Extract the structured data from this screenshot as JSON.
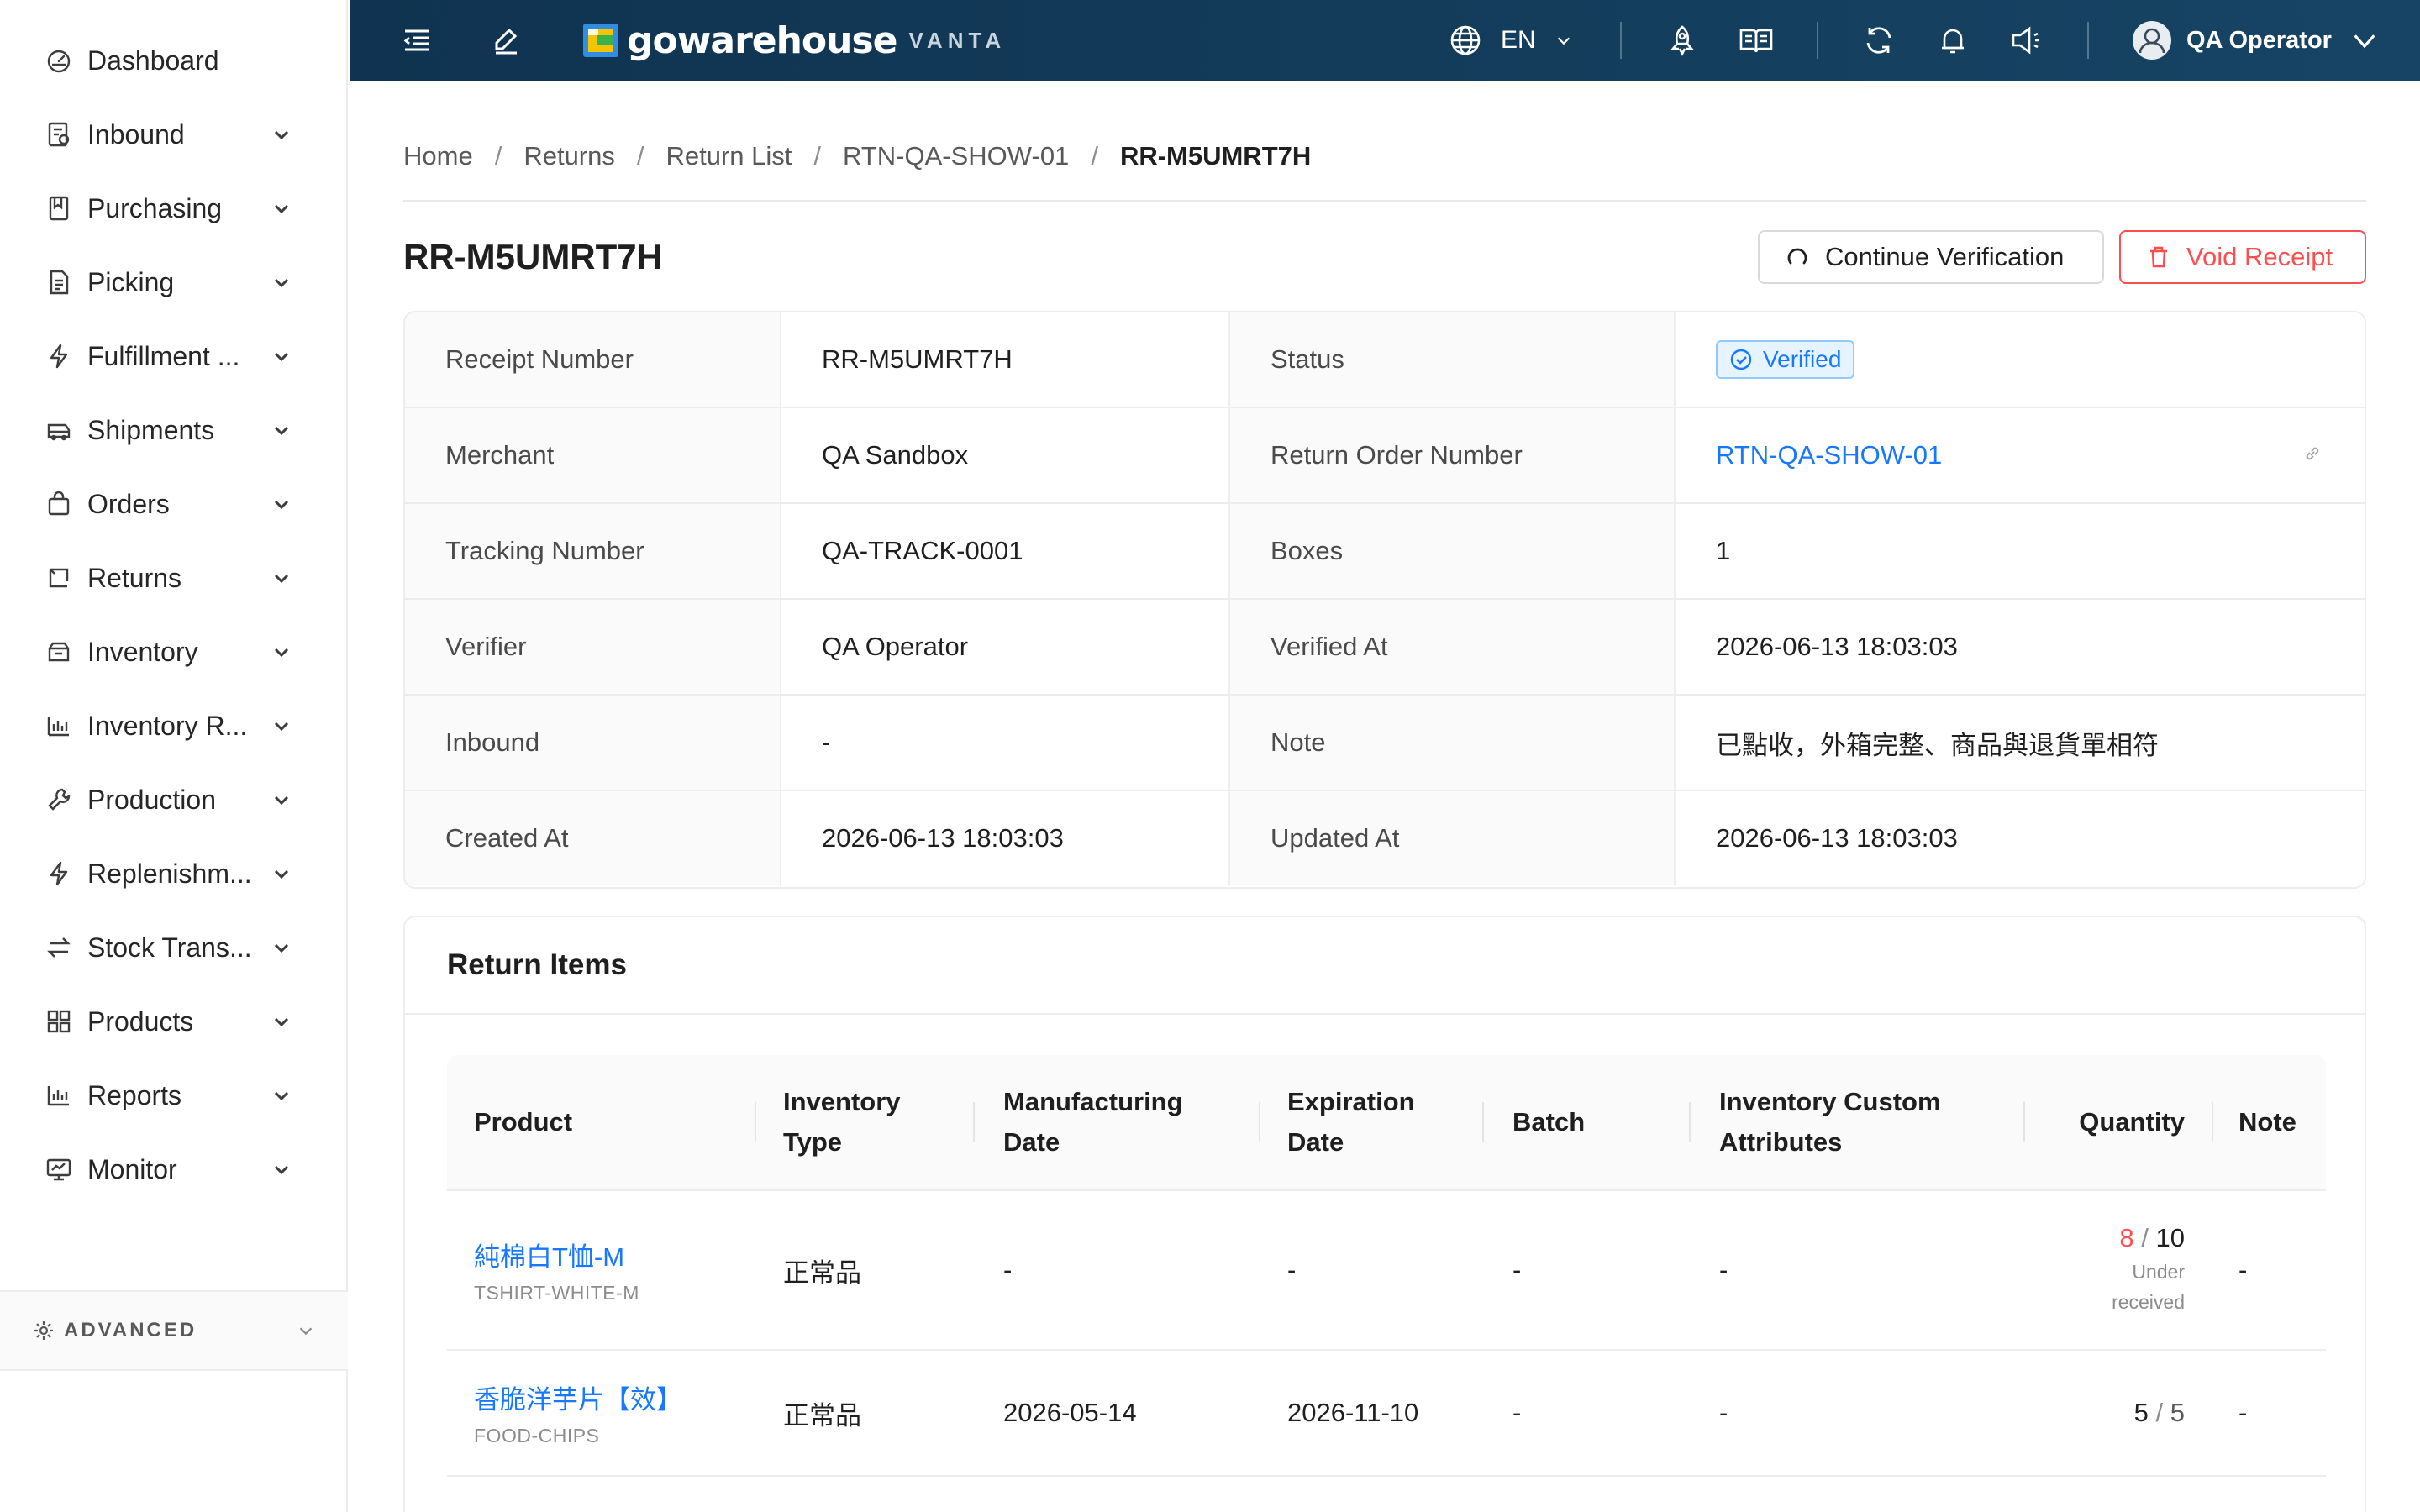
{
  "sidebar": {
    "items": [
      {
        "label": "Dashboard",
        "icon": "dashboard-icon",
        "has_children": false
      },
      {
        "label": "Inbound",
        "icon": "inbound-icon",
        "has_children": true
      },
      {
        "label": "Purchasing",
        "icon": "purchasing-icon",
        "has_children": true
      },
      {
        "label": "Picking",
        "icon": "picking-icon",
        "has_children": true
      },
      {
        "label": "Fulfillment ...",
        "icon": "fulfillment-icon",
        "has_children": true
      },
      {
        "label": "Shipments",
        "icon": "shipments-icon",
        "has_children": true
      },
      {
        "label": "Orders",
        "icon": "orders-icon",
        "has_children": true
      },
      {
        "label": "Returns",
        "icon": "returns-icon",
        "has_children": true
      },
      {
        "label": "Inventory",
        "icon": "inventory-icon",
        "has_children": true
      },
      {
        "label": "Inventory R...",
        "icon": "inventory-reports-icon",
        "has_children": true
      },
      {
        "label": "Production",
        "icon": "production-icon",
        "has_children": true
      },
      {
        "label": "Replenishm...",
        "icon": "replenishment-icon",
        "has_children": true
      },
      {
        "label": "Stock Trans...",
        "icon": "stock-transfer-icon",
        "has_children": true
      },
      {
        "label": "Products",
        "icon": "products-icon",
        "has_children": true
      },
      {
        "label": "Reports",
        "icon": "reports-icon",
        "has_children": true
      },
      {
        "label": "Monitor",
        "icon": "monitor-icon",
        "has_children": true
      }
    ],
    "advanced_label": "ADVANCED"
  },
  "header": {
    "brand": "gowarehouse",
    "brand_sub": "VANTA",
    "language": "EN",
    "user_name": "QA Operator",
    "colors": {
      "bg": "#0f3350",
      "logo_yellow": "#f5c400",
      "logo_blue": "#2f8de4",
      "logo_green": "#37b24d"
    }
  },
  "breadcrumb": {
    "items": [
      "Home",
      "Returns",
      "Return List",
      "RTN-QA-SHOW-01"
    ],
    "current": "RR-M5UMRT7H"
  },
  "page": {
    "title": "RR-M5UMRT7H",
    "continue_label": "Continue Verification",
    "void_label": "Void Receipt"
  },
  "details": {
    "receipt_number_label": "Receipt Number",
    "receipt_number": "RR-M5UMRT7H",
    "status_label": "Status",
    "status": "Verified",
    "merchant_label": "Merchant",
    "merchant": "QA Sandbox",
    "return_order_label": "Return Order Number",
    "return_order": "RTN-QA-SHOW-01",
    "tracking_label": "Tracking Number",
    "tracking": "QA-TRACK-0001",
    "boxes_label": "Boxes",
    "boxes": "1",
    "verifier_label": "Verifier",
    "verifier": "QA Operator",
    "verified_at_label": "Verified At",
    "verified_at": "2026-06-13 18:03:03",
    "inbound_label": "Inbound",
    "inbound": "-",
    "note_label": "Note",
    "note": "已點收，外箱完整、商品與退貨單相符",
    "created_at_label": "Created At",
    "created_at": "2026-06-13 18:03:03",
    "updated_at_label": "Updated At",
    "updated_at": "2026-06-13 18:03:03"
  },
  "items": {
    "title": "Return Items",
    "columns": {
      "product": "Product",
      "inventory_type_1": "Inventory",
      "inventory_type_2": "Type",
      "mfg_1": "Manufacturing",
      "mfg_2": "Date",
      "exp_1": "Expiration",
      "exp_2": "Date",
      "batch": "Batch",
      "attrs_1": "Inventory Custom",
      "attrs_2": "Attributes",
      "quantity": "Quantity",
      "note": "Note"
    },
    "rows": [
      {
        "name": "純棉白T恤-M",
        "sku": "TSHIRT-WHITE-M",
        "inventory_type": "正常品",
        "mfg_date": "-",
        "exp_date": "-",
        "batch": "-",
        "attrs": "-",
        "qty_received": "8",
        "qty_expected": "10",
        "qty_note_1": "Under",
        "qty_note_2": "received",
        "note": "-"
      },
      {
        "name": "香脆洋芋片【效】",
        "sku": "FOOD-CHIPS",
        "inventory_type": "正常品",
        "mfg_date": "2026-05-14",
        "exp_date": "2026-11-10",
        "batch": "-",
        "attrs": "-",
        "qty_received": "5",
        "qty_expected": "5",
        "note": "-"
      }
    ]
  }
}
